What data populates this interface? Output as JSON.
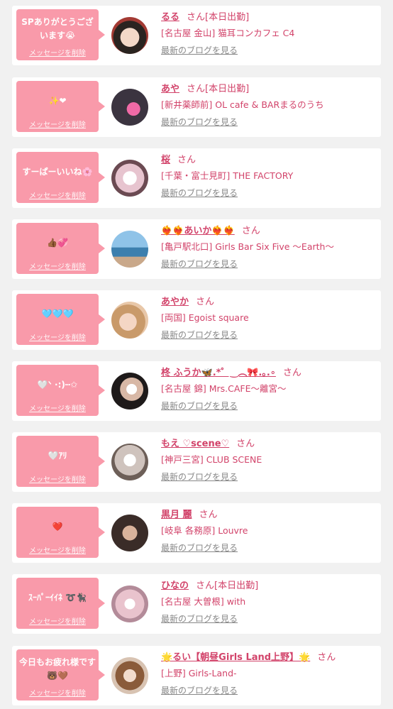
{
  "delete_label": "メッセージを削除",
  "blog_label": "最新のブログを見る",
  "san_label": "さん",
  "items": [
    {
      "message": "SPありがとうございます😭",
      "name": "るる",
      "status": "[本日出勤]",
      "shop": "[名古屋 金山] 猫耳コンカフェ C4"
    },
    {
      "message": "✨❤",
      "name": "あや",
      "status": "[本日出勤]",
      "shop": "[新井薬師前] OL cafe & BARまるのうち"
    },
    {
      "message": "すーぱーいいね🌸",
      "name": "桜",
      "status": "",
      "shop": "[千葉・富士見町] THE FACTORY"
    },
    {
      "message": "👍🏾💞",
      "name": "❤️‍🔥❤️‍🔥あいか❤️‍🔥❤️‍🔥",
      "status": "",
      "shop": "[亀戸駅北口] Girls Bar Six Five 〜Earth〜"
    },
    {
      "message": "🩵🩵🩵",
      "name": "あやか",
      "status": "",
      "shop": "[両国] Egoist square"
    },
    {
      "message": "🤍ᐠ ·:)┅✩",
      "name": "柊 ふうか🦋.*゜‿︵🎀.｡.∘",
      "status": "",
      "shop": "[名古屋 錦] Mrs.CAFE〜離宮〜"
    },
    {
      "message": "🤍ｱﾘ",
      "name": "もえ ♡scene♡",
      "status": "",
      "shop": "[神戸三宮] CLUB SCENE"
    },
    {
      "message": "❤️",
      "name": "黒月 麗",
      "status": "",
      "shop": "[岐阜 各務原] Louvre"
    },
    {
      "message": "ｽｰﾊﾟｰｲｲﾈ ➰🐈‍⬛",
      "name": "ひなの",
      "status": "[本日出勤]",
      "shop": "[名古屋 大曽根] with"
    },
    {
      "message": "今日もお疲れ様です🐻🤎",
      "name": "🌟るい【朝昼Girls Land上野】🌟",
      "status": "",
      "shop": "[上野] Girls-Land-"
    }
  ]
}
